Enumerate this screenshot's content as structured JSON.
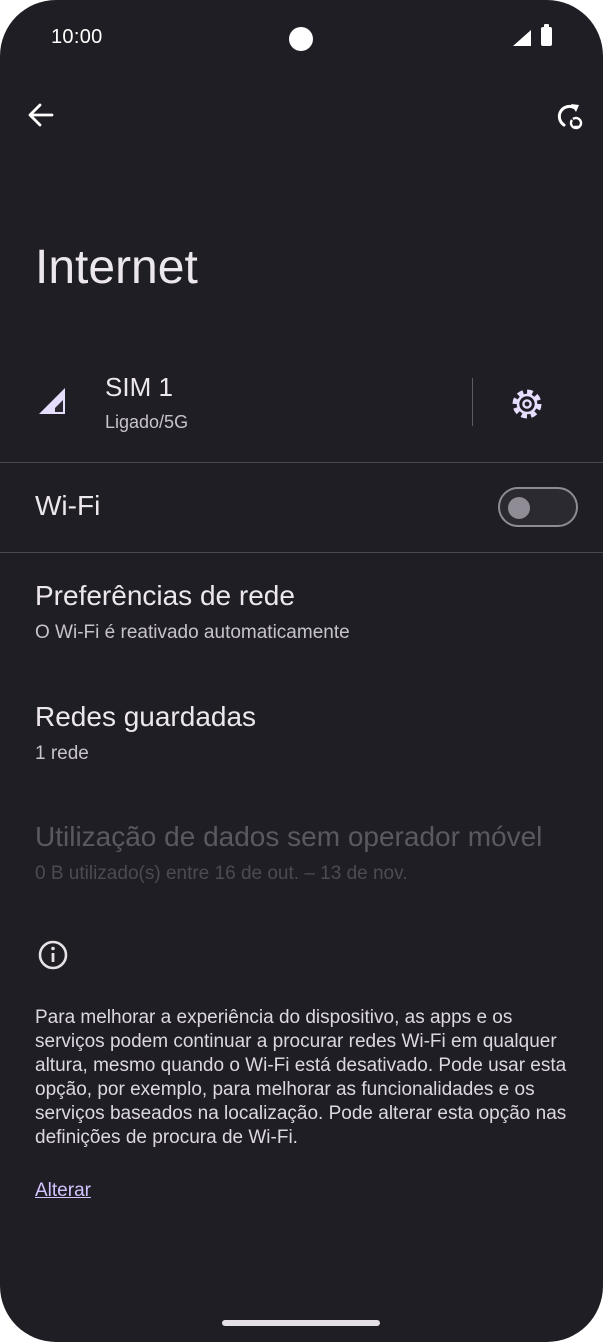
{
  "status_bar": {
    "time": "10:00"
  },
  "header": {
    "back_icon": "arrow-back-icon",
    "refresh_icon": "refresh-icon"
  },
  "page": {
    "title": "Internet"
  },
  "sim": {
    "name": "SIM 1",
    "status": "Ligado/5G",
    "icon": "signal-icon",
    "settings_icon": "gear-icon"
  },
  "wifi": {
    "label": "Wi-Fi",
    "enabled": false
  },
  "items": [
    {
      "title": "Preferências de rede",
      "subtitle": "O Wi-Fi é reativado automaticamente",
      "enabled": true
    },
    {
      "title": "Redes guardadas",
      "subtitle": "1 rede",
      "enabled": true
    },
    {
      "title": "Utilização de dados sem operador móvel",
      "subtitle": "0 B utilizado(s) entre 16 de out. – 13 de nov.",
      "enabled": false
    }
  ],
  "info": {
    "icon": "info-icon",
    "text": "Para melhorar a experiência do dispositivo, as apps e os serviços podem continuar a procurar redes Wi-Fi em qualquer altura, mesmo quando o Wi-Fi está desativado. Pode usar esta opção, por exemplo, para melhorar as funcionalidades e os serviços baseados na localização. Pode alterar esta opção nas definições de procura de Wi-Fi.",
    "link": "Alterar"
  },
  "colors": {
    "background": "#1f1e24",
    "accent": "#d3c4ff",
    "text": "#ece7ed",
    "disabled": "#5b5960"
  }
}
